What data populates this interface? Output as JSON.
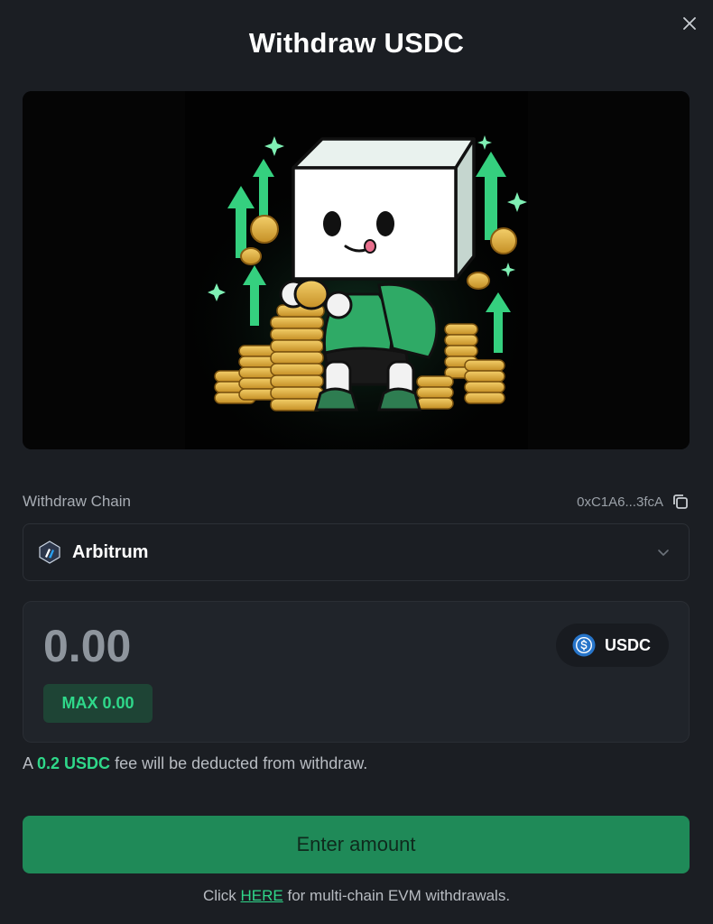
{
  "modal": {
    "title": "Withdraw USDC"
  },
  "chain": {
    "label": "Withdraw Chain",
    "address": "0xC1A6...3fcA",
    "selected": "Arbitrum"
  },
  "amount": {
    "placeholder": "0.00",
    "value": "",
    "token": "USDC",
    "max_prefix": "MAX",
    "max_value": "0.00"
  },
  "fee": {
    "prefix": "A",
    "amount": "0.2 USDC",
    "suffix": "fee will be deducted from withdraw."
  },
  "submit": {
    "label": "Enter amount"
  },
  "footer": {
    "prefix": "Click",
    "link": "HERE",
    "suffix": "for multi-chain EVM withdrawals."
  },
  "colors": {
    "accent": "#2fd88a",
    "button_bg": "#1f8a58",
    "panel_bg": "#20242a",
    "page_bg": "#1b1e23"
  },
  "icons": {
    "close": "close-icon",
    "copy": "copy-icon",
    "chain": "arbitrum-logo-icon",
    "dropdown": "chevron-down-icon",
    "token": "usdc-coin-icon"
  }
}
